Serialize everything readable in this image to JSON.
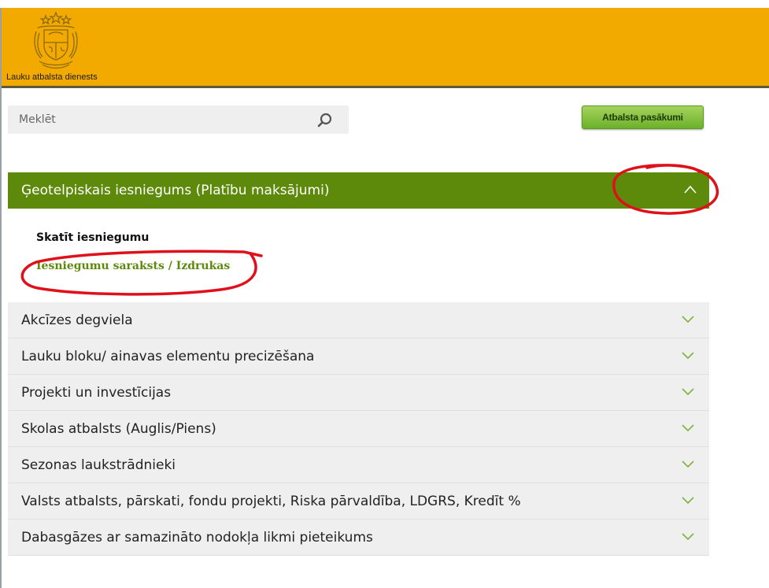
{
  "header": {
    "brand_text": "Lauku atbalsta dienests",
    "logo_icon": "latvia-coat-of-arms-icon",
    "background": "#f2a900"
  },
  "search": {
    "placeholder": "Meklēt",
    "value": "",
    "icon": "search-icon"
  },
  "support_button": {
    "label": "Atbalsta pasākumi",
    "color": "#6bb12a"
  },
  "open_section": {
    "title": "Ģeotelpiskais iesniegums (Platību maksājumi)",
    "expanded": true,
    "icon": "chevron-up-icon",
    "color": "#5e8a0c",
    "links": [
      {
        "label": "Skatīt iesniegumu"
      },
      {
        "label": "Iesniegumu saraksts / Izdrukas"
      }
    ]
  },
  "sections": [
    {
      "title": "Akcīzes degviela",
      "icon": "chevron-down-icon"
    },
    {
      "title": "Lauku bloku/ ainavas elementu precizēšana",
      "icon": "chevron-down-icon"
    },
    {
      "title": "Projekti un investīcijas",
      "icon": "chevron-down-icon"
    },
    {
      "title": "Skolas atbalsts (Auglis/Piens)",
      "icon": "chevron-down-icon"
    },
    {
      "title": "Sezonas laukstrādnieki",
      "icon": "chevron-down-icon"
    },
    {
      "title": "Valsts atbalsts, pārskati, fondu projekti, Riska pārvaldība, LDGRS, Kredīt %",
      "icon": "chevron-down-icon"
    },
    {
      "title": "Dabasgāzes ar samazināto nodokļa likmi pieteikums",
      "icon": "chevron-down-icon"
    }
  ],
  "annotations": {
    "color": "#e0101b"
  }
}
